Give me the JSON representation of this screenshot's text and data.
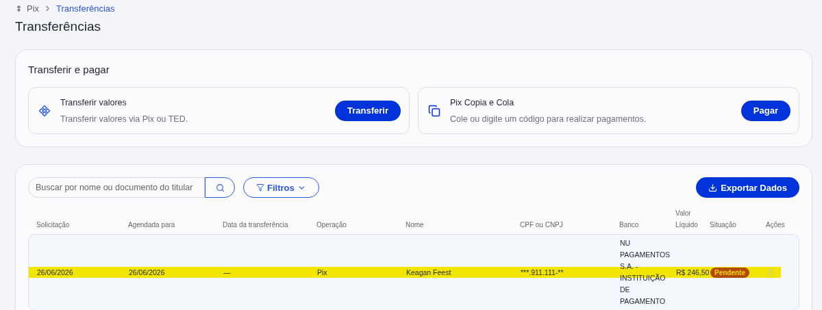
{
  "breadcrumb": [
    {
      "label": "Pix",
      "selected": false
    },
    {
      "label": "Transferências",
      "selected": true
    }
  ],
  "title": "Transferências",
  "transfer_section": {
    "title": "Transferir e pagar",
    "cards": [
      {
        "kind": "transfer",
        "title": "Transferir valores",
        "description": "Transferir valores via Pix ou TED.",
        "button": "Transferir"
      },
      {
        "kind": "copy",
        "title": "Pix Copia e Cola",
        "description": "Cole ou digite um código para realizar pagamentos.",
        "button": "Pagar"
      }
    ]
  },
  "toolbar": {
    "search": {
      "placeholder": "Buscar por nome ou documento do titular"
    },
    "filters_button": "Filtros",
    "export_button": "Exportar Dados"
  },
  "table": {
    "columns": [
      "Solicitação",
      "Agendada para",
      "Data da transferência",
      "Operação",
      "Nome",
      "CPF ou CNPJ",
      "Banco",
      "Valor Líquido",
      "Situação",
      "Ações"
    ],
    "rows": [
      {
        "highlighted": true,
        "cells": [
          "26/06/2026",
          "26/06/2026",
          "—",
          "Pix",
          "Keagan Feest",
          "***.911.111-**",
          "NU PAGAMENTOS S.A. - INSTITUIÇÃO DE PAGAMENTO",
          "R$ 246,50"
        ],
        "status": "Pendente",
        "color": "#b24a0c"
      }
    ]
  }
}
